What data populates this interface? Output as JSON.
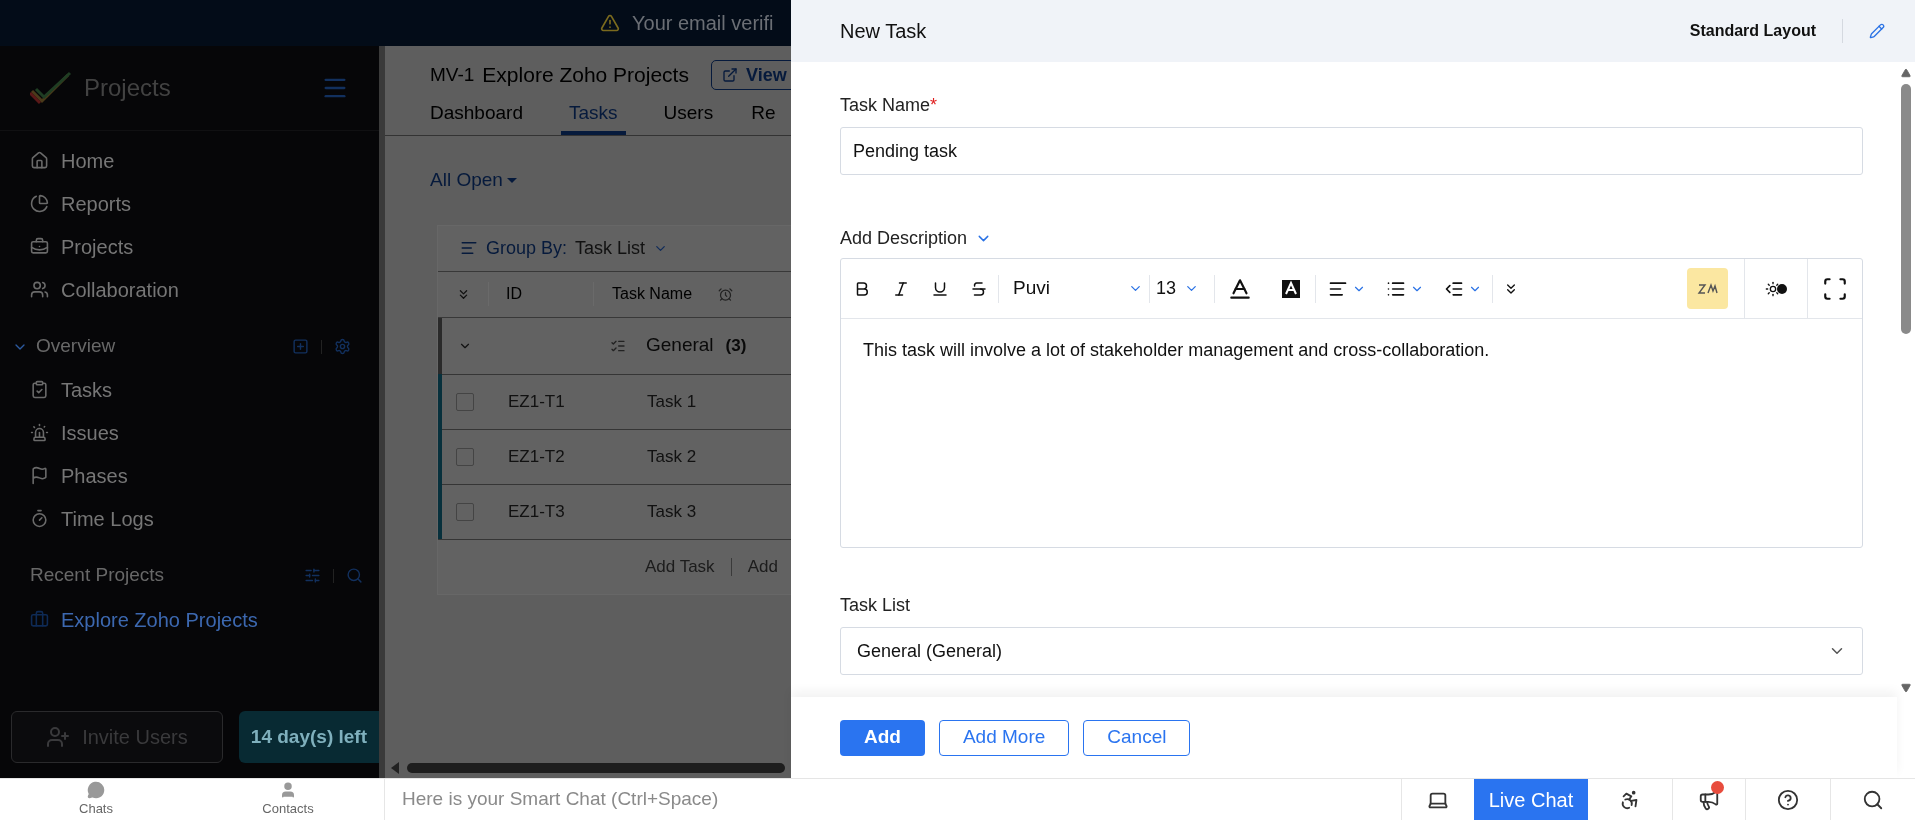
{
  "banner": {
    "text": "Your email verifi"
  },
  "sidebar": {
    "logo_text": "Projects",
    "items": [
      {
        "label": "Home"
      },
      {
        "label": "Reports"
      },
      {
        "label": "Projects"
      },
      {
        "label": "Collaboration"
      }
    ],
    "overview": {
      "label": "Overview",
      "expanded": true,
      "items": [
        {
          "label": "Tasks"
        },
        {
          "label": "Issues"
        },
        {
          "label": "Phases"
        },
        {
          "label": "Time Logs"
        }
      ]
    },
    "recent": {
      "label": "Recent Projects",
      "items": [
        "Explore Zoho Projects"
      ]
    },
    "invite_button": "Invite Users",
    "trial_badge": "14 day(s) left"
  },
  "main": {
    "project_id": "MV-1",
    "project_name": "Explore Zoho Projects",
    "view_button": "View",
    "tabs": [
      {
        "label": "Dashboard",
        "selected": false
      },
      {
        "label": "Tasks",
        "selected": true
      },
      {
        "label": "Users",
        "selected": false
      },
      {
        "label": "Re",
        "selected": false
      }
    ],
    "filter": "All Open",
    "table": {
      "group_by_label": "Group By:",
      "group_by_value": "Task List",
      "columns": [
        "ID",
        "Task Name"
      ],
      "group": {
        "name": "General",
        "count": "(3)"
      },
      "rows": [
        {
          "id": "EZ1-T1",
          "name": "Task 1",
          "checked": false
        },
        {
          "id": "EZ1-T2",
          "name": "Task 2",
          "checked": false
        },
        {
          "id": "EZ1-T3",
          "name": "Task 3",
          "checked": false
        }
      ],
      "add_task": "Add Task",
      "add_other": "Add"
    }
  },
  "panel": {
    "title": "New Task",
    "layout": "Standard Layout",
    "task_name": {
      "label": "Task Name",
      "required": true,
      "required_mark": "*",
      "value": "Pending task"
    },
    "description": {
      "label": "Add Description",
      "font": "Puvi",
      "size": "13",
      "text": "This task will involve a lot of stakeholder management and cross-collaboration."
    },
    "task_list": {
      "label": "Task List",
      "value": "General (General)"
    },
    "buttons": [
      {
        "label": "Add",
        "kind": "primary"
      },
      {
        "label": "Add More",
        "kind": "outline"
      },
      {
        "label": "Cancel",
        "kind": "outline"
      }
    ]
  },
  "bottom_bar": {
    "chats": "Chats",
    "contacts": "Contacts",
    "smart_chat_placeholder": "Here is your Smart Chat (Ctrl+Space)",
    "live_chat": "Live Chat",
    "notification": true
  }
}
